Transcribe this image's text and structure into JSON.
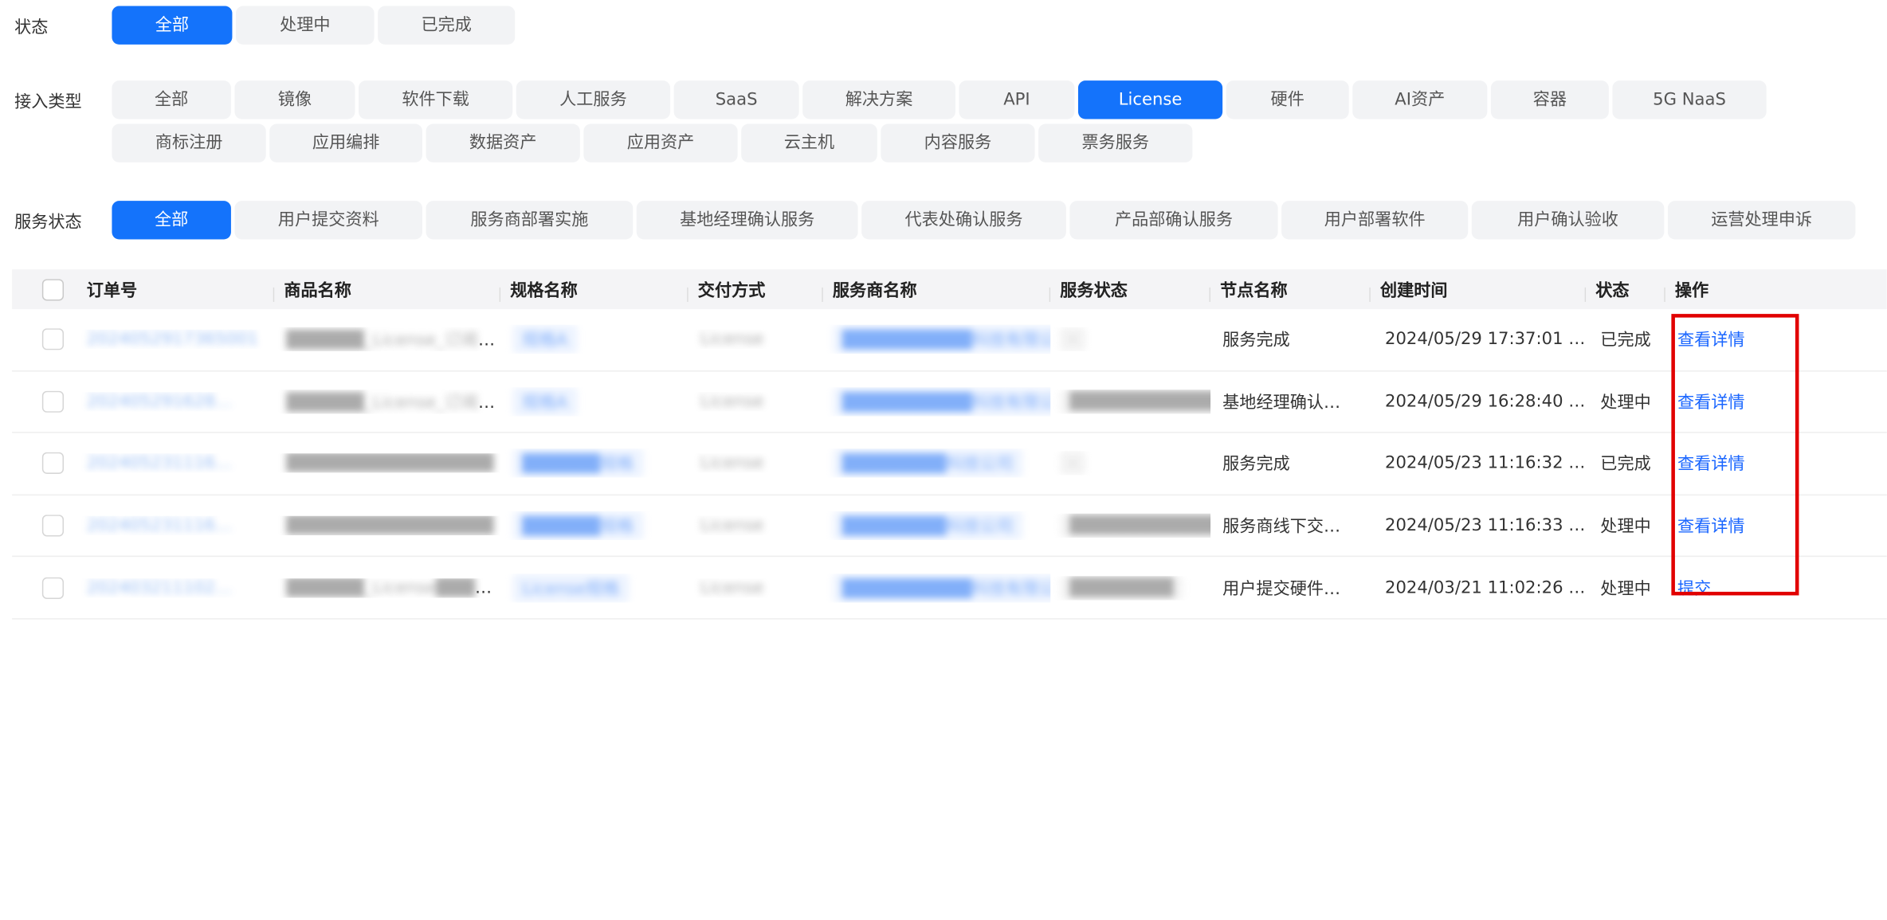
{
  "filters": {
    "status": {
      "label": "状态",
      "options": [
        "全部",
        "处理中",
        "已完成"
      ],
      "active_index": 0
    },
    "access_type": {
      "label": "接入类型",
      "options": [
        "全部",
        "镜像",
        "软件下载",
        "人工服务",
        "SaaS",
        "解决方案",
        "API",
        "License",
        "硬件",
        "AI资产",
        "容器",
        "5G NaaS",
        "商标注册",
        "应用编排",
        "数据资产",
        "应用资产",
        "云主机",
        "内容服务",
        "票务服务"
      ],
      "active_index": 7
    },
    "service_status": {
      "label": "服务状态",
      "options": [
        "全部",
        "用户提交资料",
        "服务商部署实施",
        "基地经理确认服务",
        "代表处确认服务",
        "产品部确认服务",
        "用户部署软件",
        "用户确认验收",
        "运营处理申诉"
      ],
      "active_index": 0
    }
  },
  "table": {
    "columns": [
      "订单号",
      "商品名称",
      "规格名称",
      "交付方式",
      "服务商名称",
      "服务状态",
      "节点名称",
      "创建时间",
      "状态",
      "操作"
    ],
    "rows": [
      {
        "order_no": "2024052917365001",
        "product": "██████_License_订阅版本",
        "spec": "规格A",
        "delivery": "License",
        "provider": "██████████科技有限公司",
        "service_status": "-",
        "node": "服务完成",
        "created": "2024/05/29 17:37:01 …",
        "status": "已完成",
        "action": "查看详情"
      },
      {
        "order_no": "202405291628…",
        "product": "██████_License_订阅版本",
        "spec": "规格A",
        "delivery": "License",
        "provider": "██████████科技有限公司",
        "service_status": "████████████",
        "node": "基地经理确认…",
        "created": "2024/05/29 16:28:40 …",
        "status": "处理中",
        "action": "查看详情"
      },
      {
        "order_no": "202405231116…",
        "product": "████████████████",
        "spec": "██████规格",
        "delivery": "License",
        "provider": "████████科技公司",
        "service_status": "-",
        "node": "服务完成",
        "created": "2024/05/23 11:16:32 …",
        "status": "已完成",
        "action": "查看详情"
      },
      {
        "order_no": "202405231116…",
        "product": "████████████████",
        "spec": "██████规格",
        "delivery": "License",
        "provider": "████████科技公司",
        "service_status": "████████████",
        "node": "服务商线下交…",
        "created": "2024/05/23 11:16:33 …",
        "status": "处理中",
        "action": "查看详情"
      },
      {
        "order_no": "202403211102…",
        "product": "██████_License████…",
        "spec": "License规格",
        "delivery": "License",
        "provider": "██████████科技有限公司",
        "service_status": "████████",
        "node": "用户提交硬件…",
        "created": "2024/03/21 11:02:26 …",
        "status": "处理中",
        "action": "提交"
      }
    ]
  },
  "colors": {
    "accent": "#1473fb",
    "chip_bg": "#f2f3f5",
    "header_bg": "#f4f4f6",
    "link": "#1a66ff",
    "highlight": "#e10000"
  }
}
